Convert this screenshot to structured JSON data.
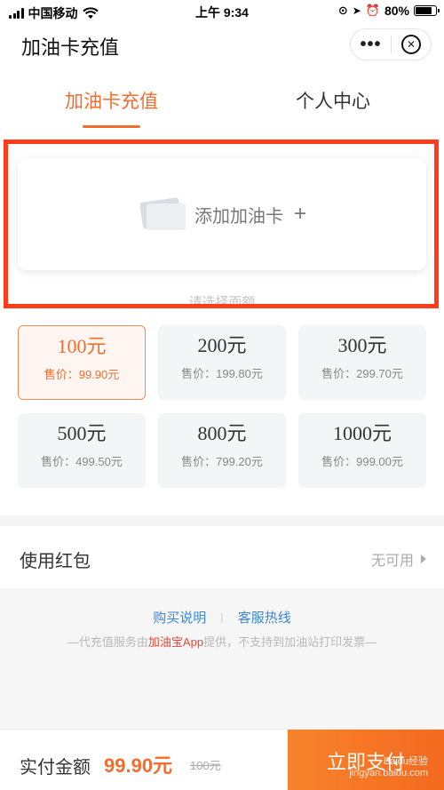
{
  "status_bar": {
    "carrier": "中国移动",
    "time": "上午 9:34",
    "battery": "80%",
    "battery_level": 0.8
  },
  "nav": {
    "title": "加油卡充值",
    "more_icon": "more-dots-icon",
    "close_icon": "close-circle-icon"
  },
  "tabs": [
    {
      "label": "加油卡充值",
      "active": true
    },
    {
      "label": "个人中心",
      "active": false
    }
  ],
  "card": {
    "label": "添加加油卡",
    "plus": "+",
    "hint": "请选择面额"
  },
  "amounts": [
    {
      "value": "100元",
      "price": "售价：99.90元",
      "selected": true
    },
    {
      "value": "200元",
      "price": "售价：199.80元",
      "selected": false
    },
    {
      "value": "300元",
      "price": "售价：299.70元",
      "selected": false
    },
    {
      "value": "500元",
      "price": "售价：499.50元",
      "selected": false
    },
    {
      "value": "800元",
      "price": "售价：799.20元",
      "selected": false
    },
    {
      "value": "1000元",
      "price": "售价：999.00元",
      "selected": false
    }
  ],
  "coupon": {
    "label": "使用红包",
    "value": "无可用"
  },
  "info": {
    "link1": "购买说明",
    "separator": "|",
    "link2": "客服热线",
    "notice_pre": "—代充值服务由",
    "notice_brand": "加油宝App",
    "notice_post": "提供，不支持到加油站打印发票—"
  },
  "payment": {
    "label": "实付金额",
    "amount": "99.90元",
    "original": "100元",
    "button": "立即支付"
  },
  "watermark": {
    "line1": "Baidu经验",
    "line2": "jingyan.baidu.com"
  },
  "colors": {
    "accent": "#f26d2e",
    "highlight_box": "#ff3d1a",
    "link": "#3a87d6"
  }
}
